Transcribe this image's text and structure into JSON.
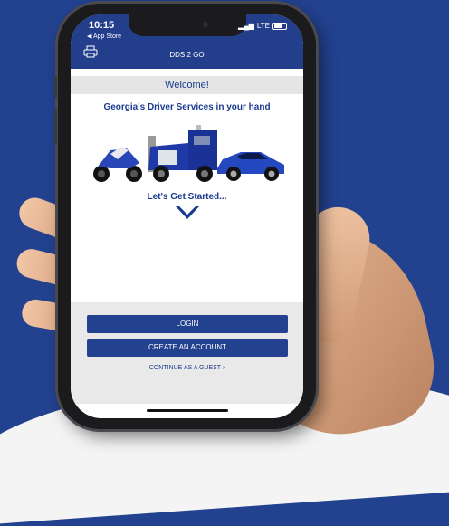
{
  "status_bar": {
    "time": "10:15",
    "back_label": "◀ App Store",
    "signal": "LTE"
  },
  "header": {
    "title": "DDS 2 GO"
  },
  "welcome": {
    "title": "Welcome!"
  },
  "hero": {
    "tagline": "Georgia's Driver Services in your hand",
    "started": "Let's Get Started..."
  },
  "actions": {
    "login": "LOGIN",
    "create_account": "CREATE AN ACCOUNT",
    "guest": "CONTINUE AS A GUEST",
    "guest_arrow": "›"
  },
  "colors": {
    "brand_blue": "#233e8b",
    "background": "#22418f"
  }
}
